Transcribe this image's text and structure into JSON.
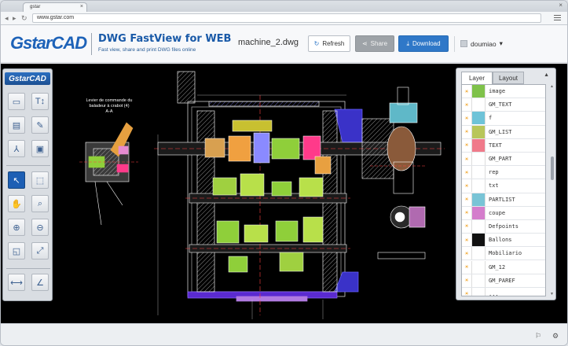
{
  "browser": {
    "tab_title": "gstar",
    "tab_close": "×",
    "window_close": "×",
    "url": "www.gstar.com",
    "back": "◂",
    "forward": "▸",
    "reload": "↻"
  },
  "header": {
    "logo": "GstarCAD",
    "app_title": "DWG FastView for WEB",
    "app_subtitle": "Fast view, share and print DWG files online",
    "filename": "machine_2.dwg",
    "refresh_label": "Refresh",
    "share_label": "Share",
    "download_label": "Download",
    "user_name": "doumiao",
    "user_caret": "▾",
    "refresh_icon": "↻",
    "share_icon": "⋖",
    "download_icon": "⤓"
  },
  "toolbar": {
    "logo": "GstarCAD",
    "tools": [
      {
        "name": "open-file",
        "glyph": "▭"
      },
      {
        "name": "text-size",
        "glyph": "T↕"
      },
      {
        "name": "print",
        "glyph": "▤"
      },
      {
        "name": "annotate",
        "glyph": "✎"
      },
      {
        "name": "pdf",
        "glyph": "⅄"
      },
      {
        "name": "image",
        "glyph": "▣"
      },
      {
        "name": "select",
        "glyph": "↖"
      },
      {
        "name": "zoom-window",
        "glyph": "⬚"
      },
      {
        "name": "pan",
        "glyph": "✋"
      },
      {
        "name": "zoom",
        "glyph": "⌕"
      },
      {
        "name": "zoom-in",
        "glyph": "⊕"
      },
      {
        "name": "zoom-out",
        "glyph": "⊖"
      },
      {
        "name": "zoom-previous",
        "glyph": "◱"
      },
      {
        "name": "zoom-extents",
        "glyph": "⤢"
      },
      {
        "name": "measure-distance",
        "glyph": "⟷"
      },
      {
        "name": "measure-angle",
        "glyph": "∠"
      }
    ]
  },
  "drawing": {
    "annotation_line1": "Levier de commande du",
    "annotation_line2": "baladeur à crabot (4)",
    "annotation_line3": "A-A"
  },
  "layer_panel": {
    "tab_layer": "Layer",
    "tab_layout": "Layout",
    "toggle": "▲",
    "scroll_up": "▲",
    "scroll_down": "▼",
    "layers": [
      {
        "name": "image",
        "color": "#7fc24a"
      },
      {
        "name": "GM_TEXT",
        "color": "#ffffff"
      },
      {
        "name": "f",
        "color": "#6ec3d8"
      },
      {
        "name": "GM_LIST",
        "color": "#b8c65a"
      },
      {
        "name": "TEXT",
        "color": "#f07a8a"
      },
      {
        "name": "GM_PART",
        "color": "#ffffff"
      },
      {
        "name": "rep",
        "color": "#ffffff"
      },
      {
        "name": "txt",
        "color": "#ffffff"
      },
      {
        "name": "PARTLIST",
        "color": "#79c4d6"
      },
      {
        "name": "coupe",
        "color": "#d47dcc"
      },
      {
        "name": "Defpoints",
        "color": "#ffffff"
      },
      {
        "name": "Ballons",
        "color": "#111111"
      },
      {
        "name": "Mobiliario",
        "color": "#ffffff"
      },
      {
        "name": "GM_12",
        "color": "#ffffff"
      },
      {
        "name": "GM_PAREF",
        "color": "#ffffff"
      },
      {
        "name": "...",
        "color": "#ffffff"
      }
    ]
  },
  "status": {
    "icon_left": "⚐",
    "icon_right": "⚙"
  }
}
